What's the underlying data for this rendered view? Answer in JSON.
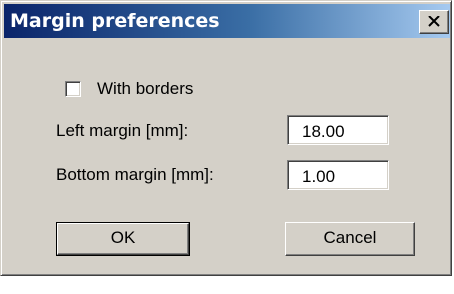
{
  "window": {
    "title": "Margin preferences",
    "close_icon": "close-icon"
  },
  "options": {
    "with_borders_label": "With borders",
    "with_borders_checked": false
  },
  "fields": {
    "left_margin_label": "Left margin [mm]:",
    "left_margin_value": "18.00",
    "bottom_margin_label": "Bottom margin [mm]:",
    "bottom_margin_value": "1.00"
  },
  "buttons": {
    "ok_label": "OK",
    "cancel_label": "Cancel"
  },
  "colors": {
    "title_gradient_start": "#0a246a",
    "title_gradient_end": "#a6caf0",
    "face": "#d4d0c8"
  }
}
